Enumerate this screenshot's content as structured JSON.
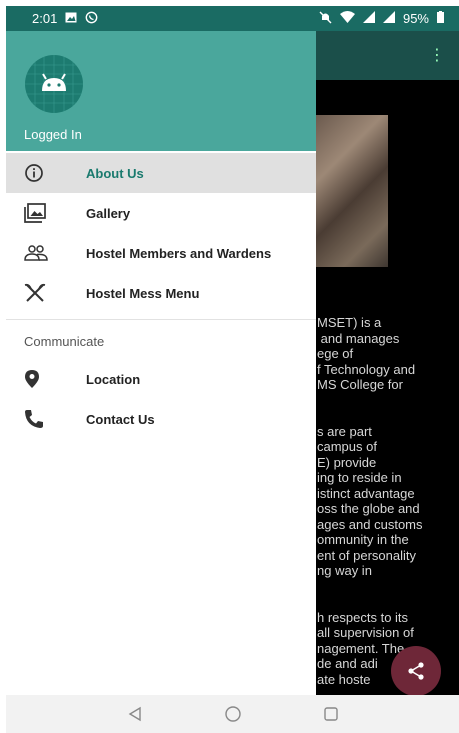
{
  "status_bar": {
    "time": "2:01",
    "battery": "95%"
  },
  "drawer": {
    "header_label": "Logged In",
    "items": [
      {
        "label": "About Us",
        "icon": "info-icon",
        "active": true
      },
      {
        "label": "Gallery",
        "icon": "gallery-icon",
        "active": false
      },
      {
        "label": "Hostel Members and Wardens",
        "icon": "people-icon",
        "active": false
      },
      {
        "label": "Hostel Mess Menu",
        "icon": "utensils-icon",
        "active": false
      }
    ],
    "section_title": "Communicate",
    "communicate_items": [
      {
        "label": "Location",
        "icon": "location-pin-icon"
      },
      {
        "label": "Contact Us",
        "icon": "phone-icon"
      }
    ]
  },
  "background_text": "MSET) is a\n and manages\nege of\nf Technology and\nMS College for\n\n\ns are part\ncampus of\nE) provide\ning to reside in\nistinct advantage\noss the globe and\nages and customs\nommunity in the\nent of personality\nng way in\n\n\nh respects to its\nall supervision of\nnagement. The\nde and adi     to\nate hoste",
  "colors": {
    "status_bar": "#1a6b63",
    "drawer_header": "#4aa79c",
    "accent": "#1a7a6e",
    "fab": "#6e2738"
  }
}
